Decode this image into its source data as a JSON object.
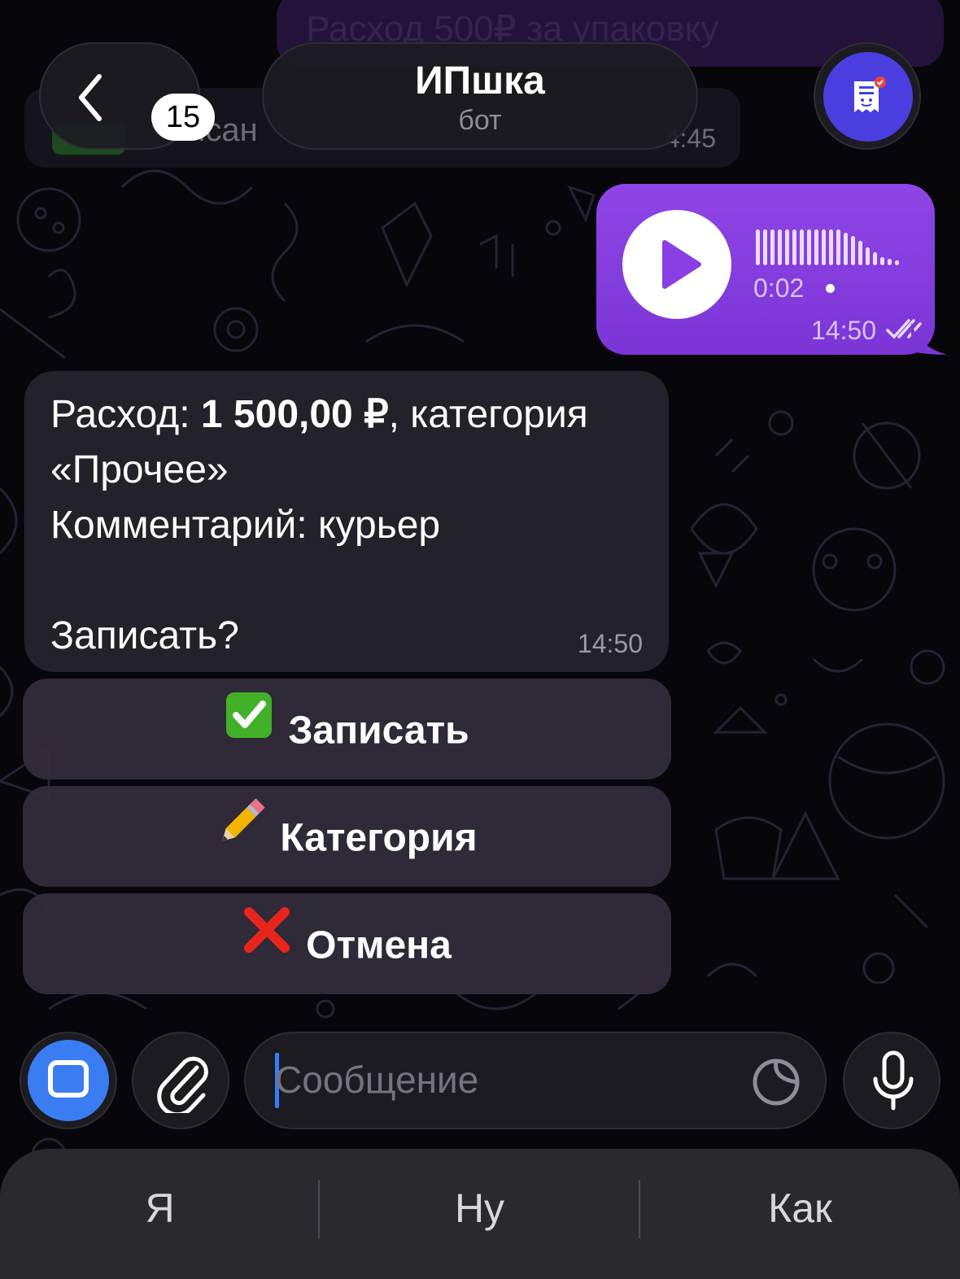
{
  "header": {
    "back_count": "15",
    "chat_title": "ИПшка",
    "chat_subtitle": "бот"
  },
  "ghost": {
    "top_text": "Расход 500₽ за упаковку",
    "left_text": "исан",
    "left_time": "4:45"
  },
  "voice_message": {
    "duration": "0:02",
    "time": "14:50",
    "status": "read"
  },
  "bot_message": {
    "line1_prefix": "Расход: ",
    "line1_amount": "1 500,00 ₽",
    "line1_suffix": ", категория",
    "line2": "«Прочее»",
    "line3": "Комментарий: курьер",
    "line4": "Записать?",
    "time": "14:50"
  },
  "inline_keyboard": [
    {
      "icon": "check-mark-icon",
      "label": "Записать"
    },
    {
      "icon": "pencil-icon",
      "label": "Категория"
    },
    {
      "icon": "cross-mark-icon",
      "label": "Отмена"
    }
  ],
  "composer": {
    "placeholder": "Сообщение"
  },
  "predictive": [
    "Я",
    "Ну",
    "Как"
  ],
  "colors": {
    "outgoing_bubble": "#8f45e6",
    "incoming_bubble": "#24222c",
    "accent": "#3a7df2",
    "avatar": "#4a3ee0"
  }
}
